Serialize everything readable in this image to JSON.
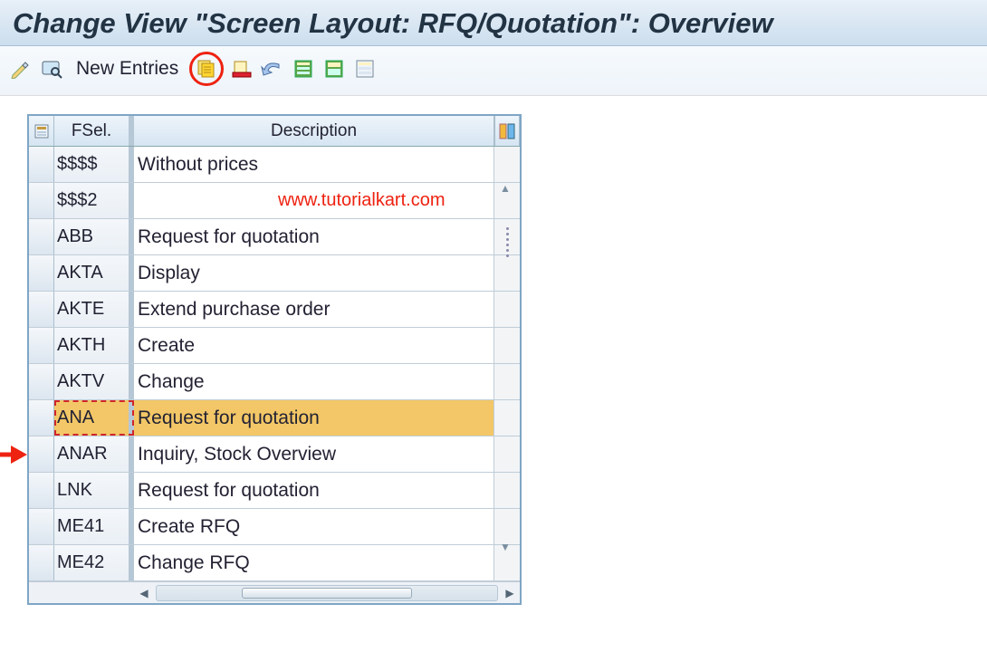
{
  "header": {
    "title": "Change View \"Screen Layout: RFQ/Quotation\": Overview"
  },
  "toolbar": {
    "new_entries_label": "New Entries"
  },
  "grid": {
    "col_fsel": "FSel.",
    "col_desc": "Description",
    "rows": [
      {
        "fsel": "$$$$",
        "desc": "Without prices",
        "highlight": false
      },
      {
        "fsel": "$$$2",
        "desc": "",
        "highlight": false
      },
      {
        "fsel": "ABB",
        "desc": "Request for quotation",
        "highlight": false
      },
      {
        "fsel": "AKTA",
        "desc": "Display",
        "highlight": false
      },
      {
        "fsel": "AKTE",
        "desc": "Extend purchase order",
        "highlight": false
      },
      {
        "fsel": "AKTH",
        "desc": "Create",
        "highlight": false
      },
      {
        "fsel": "AKTV",
        "desc": "Change",
        "highlight": false
      },
      {
        "fsel": "ANA",
        "desc": "Request for quotation",
        "highlight": true
      },
      {
        "fsel": "ANAR",
        "desc": "Inquiry, Stock Overview",
        "highlight": false
      },
      {
        "fsel": "LNK",
        "desc": "Request for quotation",
        "highlight": false
      },
      {
        "fsel": "ME41",
        "desc": "Create RFQ",
        "highlight": false
      },
      {
        "fsel": "ME42",
        "desc": "Change RFQ",
        "highlight": false
      }
    ]
  },
  "watermark": "www.tutorialkart.com"
}
